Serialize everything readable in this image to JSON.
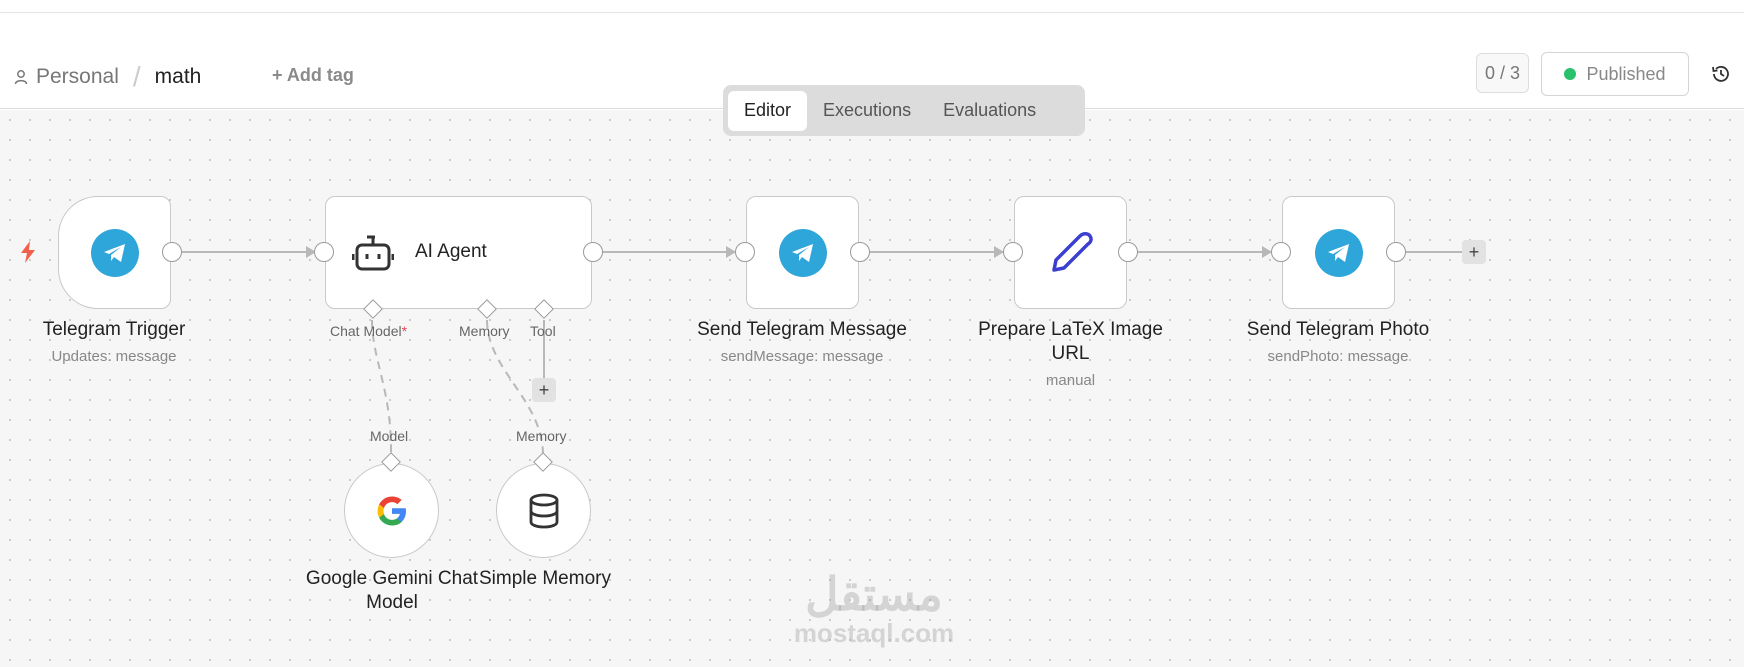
{
  "header": {
    "project": "Personal",
    "separator": "/",
    "workflow_name": "math",
    "add_tag": "+ Add tag",
    "counter": "0 / 3",
    "status": "Published"
  },
  "tabs": [
    {
      "label": "Editor",
      "active": true
    },
    {
      "label": "Executions",
      "active": false
    },
    {
      "label": "Evaluations",
      "active": false
    }
  ],
  "nodes": {
    "trigger": {
      "title": "Telegram Trigger",
      "subtitle": "Updates: message"
    },
    "agent": {
      "title": "AI Agent",
      "slot_chat_model": "Chat Model",
      "slot_required": "*",
      "slot_memory": "Memory",
      "slot_tool": "Tool"
    },
    "send_message": {
      "title": "Send Telegram Message",
      "subtitle": "sendMessage: message"
    },
    "prepare": {
      "title": "Prepare LaTeX Image URL",
      "subtitle": "manual"
    },
    "send_photo": {
      "title": "Send Telegram Photo",
      "subtitle": "sendPhoto: message"
    },
    "gemini": {
      "title": "Google Gemini Chat Model",
      "slot": "Model"
    },
    "memory": {
      "title": "Simple Memory",
      "slot": "Memory"
    }
  },
  "plus": "+",
  "watermark": {
    "arabic": "مستقل",
    "latin": "mostaql.com"
  },
  "colors": {
    "telegram": "#2ea6da",
    "published_dot": "#29c16b",
    "trigger_bolt": "#f0604d",
    "required": "#e0454f",
    "pencil": "#3b3fd0"
  }
}
